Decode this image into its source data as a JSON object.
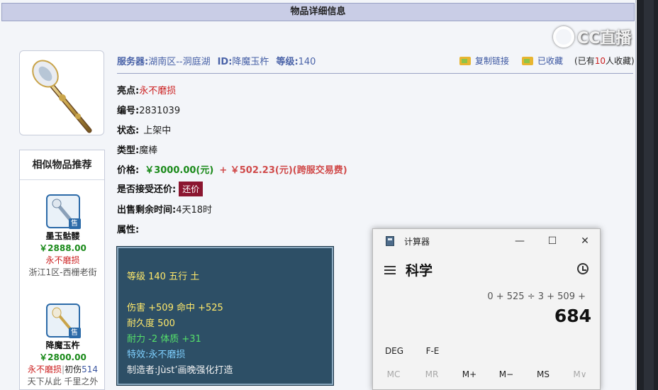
{
  "header": {
    "title": "物品详细信息"
  },
  "info": {
    "server_label": "服务器:",
    "server_value": "湖南区--洞庭湖",
    "id_label": "ID:",
    "id_value": "降魔玉杵",
    "level_label": "等级:",
    "level_value": "140"
  },
  "actions": {
    "copy_link": "复制链接",
    "favorited": "已收藏",
    "fav_prefix": "(已有",
    "fav_count": "10",
    "fav_suffix": "人收藏)"
  },
  "fields": {
    "highlight_label": "亮点:",
    "highlight_value": "永不磨损",
    "number_label": "编号:",
    "number_value": "2831039",
    "status_label": "状态:",
    "status_value": "上架中",
    "type_label": "类型:",
    "type_value": "魔棒",
    "price_label": "价格:",
    "price_value": "￥3000.00(元)",
    "price_extra": "+ ￥502.23(元)(跨服交易费)",
    "counter_label": "是否接受还价:",
    "counter_button": "还价",
    "time_label": "出售剩余时间:",
    "time_value": "4天18时",
    "attr_label": "属性:"
  },
  "similar": {
    "title": "相似物品推荐",
    "items": [
      {
        "name": "墨玉骷髅",
        "price": "￥2888.00",
        "tag": "永不磨损",
        "location": "浙江1区-西栅老街",
        "badge": "售"
      },
      {
        "name": "降魔玉杵",
        "price": "￥2800.00",
        "tag": "永不磨损",
        "tag2": "初伤",
        "tag2_value": "514",
        "location": "天下从此 千里之外",
        "badge": "售"
      }
    ]
  },
  "attributes": {
    "line1": "等级 140 五行 土",
    "line2": "伤害 +509 命中 +525",
    "line3": "耐久度 500",
    "line4": "耐力 -2 体质 +31",
    "line5": "特效:永不磨损",
    "line6": "制造者:Jùst’画晚强化打造"
  },
  "watermark": {
    "text": "CC直播"
  },
  "calculator": {
    "title": "计算器",
    "mode": "科学",
    "minimize": "—",
    "maximize": "☐",
    "close": "✕",
    "expression": "0 + 525 ÷ 3 + 509 +",
    "result": "684",
    "angle_unit": "DEG",
    "fe": "F-E",
    "mem": [
      "MC",
      "MR",
      "M+",
      "M−",
      "MS",
      "M∨"
    ]
  },
  "colors": {
    "header_bg": "#c9cde6",
    "accent_blue": "#4a63a8",
    "price_green": "#1a8a1a",
    "counter_btn": "#8b1630",
    "attr_bg": "#2d4f66"
  }
}
